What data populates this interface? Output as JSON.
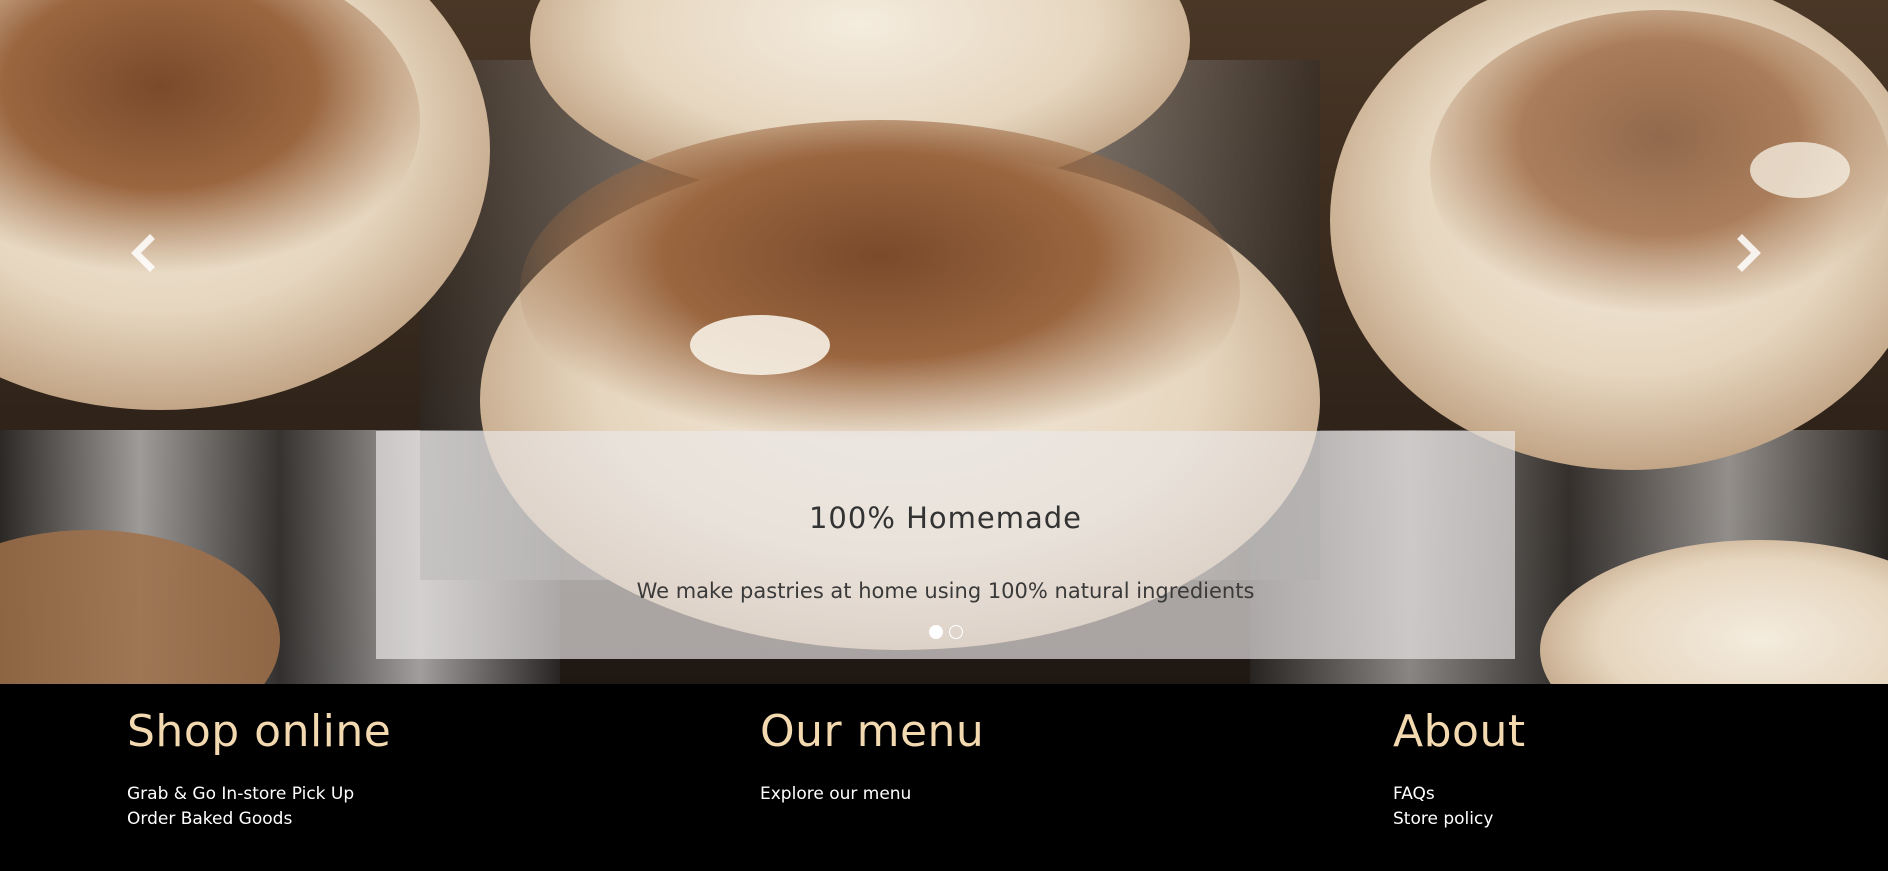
{
  "carousel": {
    "slide_title": "100% Homemade",
    "slide_text": "We make pastries at home using 100% natural ingredients",
    "active_index": 1,
    "slide_count": 2
  },
  "footer": {
    "columns": [
      {
        "heading": "Shop online",
        "links": [
          "Grab & Go In-store Pick Up",
          "Order Baked Goods"
        ]
      },
      {
        "heading": "Our menu",
        "links": [
          "Explore our menu"
        ]
      },
      {
        "heading": "About",
        "links": [
          "FAQs",
          "Store policy"
        ]
      }
    ]
  },
  "colors": {
    "footer_bg": "#000000",
    "heading": "#f3d9b0",
    "caption_bg": "rgba(235,232,232,0.68)",
    "link": "#ffffff"
  },
  "icons": {
    "prev": "chevron-left-icon",
    "next": "chevron-right-icon"
  }
}
